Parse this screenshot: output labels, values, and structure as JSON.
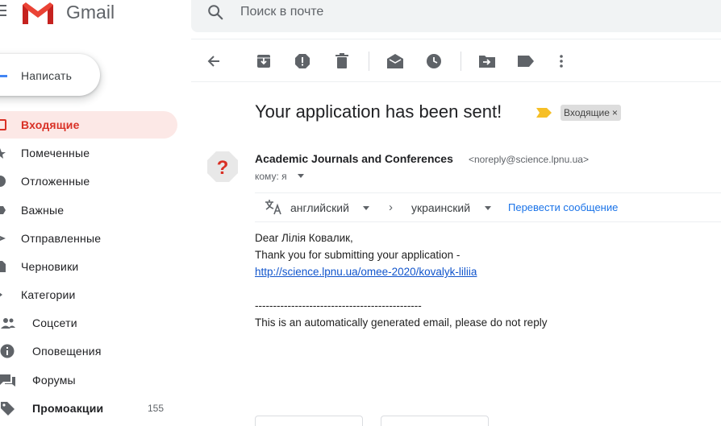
{
  "header": {
    "app_name": "Gmail",
    "search_placeholder": "Поиск в почте"
  },
  "compose": {
    "label": "Написать"
  },
  "sidebar": {
    "items": [
      {
        "label": "Входящие",
        "icon": "inbox-icon",
        "active": true
      },
      {
        "label": "Помеченные",
        "icon": "star-icon"
      },
      {
        "label": "Отложенные",
        "icon": "clock-icon"
      },
      {
        "label": "Важные",
        "icon": "important-icon"
      },
      {
        "label": "Отправленные",
        "icon": "send-icon"
      },
      {
        "label": "Черновики",
        "icon": "draft-icon"
      },
      {
        "label": "Категории",
        "icon": "label-icon"
      }
    ],
    "categories": [
      {
        "label": "Соцсети",
        "icon": "people-icon"
      },
      {
        "label": "Оповещения",
        "icon": "info-icon"
      },
      {
        "label": "Форумы",
        "icon": "forum-icon"
      },
      {
        "label": "Промоакции",
        "icon": "tag-icon",
        "count": "155",
        "bold": true
      }
    ]
  },
  "toolbar": {
    "buttons": [
      "back-icon",
      "archive-icon",
      "report-spam-icon",
      "delete-icon",
      "mark-unread-icon",
      "snooze-icon",
      "move-to-icon",
      "labels-icon",
      "more-icon"
    ]
  },
  "message": {
    "subject": "Your application has been sent!",
    "label_chip": "Входящие",
    "label_chip_close": "×",
    "avatar_glyph": "?",
    "sender_name": "Academic Journals and Conferences",
    "sender_email": "<noreply@science.lpnu.ua>",
    "to_line": "кому: я",
    "translate": {
      "from_lang": "английский",
      "arrow": "›",
      "to_lang": "украинский",
      "action": "Перевести сообщение"
    },
    "body": {
      "greeting": "Dear Лілія Ковалик,",
      "line1": "Thank you for submitting your application -",
      "link": "http://science.lpnu.ua/omee-2020/kovalyk-liliia",
      "divider": "----------------------------------------------",
      "footer": "This is an automatically generated email, please do not reply"
    }
  },
  "colors": {
    "accent_red": "#d93025",
    "active_bg": "#fce8e6",
    "link_blue": "#1155cc",
    "importance_yellow": "#f6bf26"
  }
}
